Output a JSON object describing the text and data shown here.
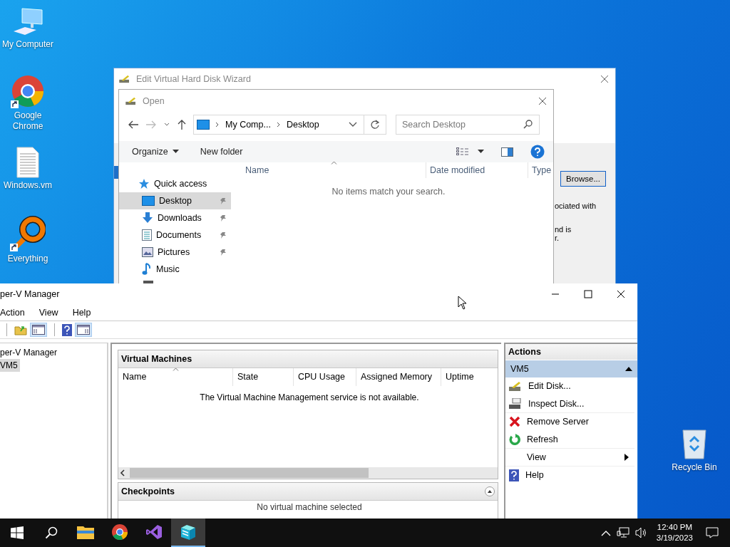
{
  "desktop_icons": [
    {
      "label": "My Computer",
      "kind": "computer",
      "shortcut": false
    },
    {
      "label": "Google Chrome",
      "kind": "chrome",
      "shortcut": true
    },
    {
      "label": "Windows.vm",
      "kind": "file",
      "shortcut": false
    },
    {
      "label": "Everything",
      "kind": "everything",
      "shortcut": true
    },
    {
      "label": "Recycle Bin",
      "kind": "bin",
      "shortcut": false
    }
  ],
  "wizard": {
    "title": "Edit Virtual Hard Disk Wizard",
    "browse_button": "Browse...",
    "text_fragments": [
      "ociated with",
      "nd is",
      "r."
    ]
  },
  "open_dialog": {
    "title": "Open",
    "breadcrumb": [
      "My Comp...",
      "Desktop"
    ],
    "search": {
      "placeholder": "Search Desktop"
    },
    "toolbar": [
      "Organize",
      "New folder"
    ],
    "nav": [
      {
        "label": "Quick access",
        "kind": "star",
        "selected": false,
        "pinned": false
      },
      {
        "label": "Desktop",
        "kind": "desktop",
        "selected": true,
        "pinned": true
      },
      {
        "label": "Downloads",
        "kind": "download",
        "selected": false,
        "pinned": true
      },
      {
        "label": "Documents",
        "kind": "document",
        "selected": false,
        "pinned": true
      },
      {
        "label": "Pictures",
        "kind": "pictures",
        "selected": false,
        "pinned": true
      },
      {
        "label": "Music",
        "kind": "music",
        "selected": false,
        "pinned": false
      }
    ],
    "columns": [
      "Name",
      "Date modified",
      "Type"
    ],
    "empty_message": "No items match your search."
  },
  "hyperv": {
    "title": "per-V Manager",
    "menu": [
      "Action",
      "View",
      "Help"
    ],
    "tree": [
      {
        "label": "per-V Manager",
        "selected": false,
        "children": [
          {
            "label": "VM5",
            "selected": true
          }
        ]
      }
    ],
    "vm_panel": {
      "title": "Virtual Machines",
      "columns": [
        "Name",
        "State",
        "CPU Usage",
        "Assigned Memory",
        "Uptime"
      ],
      "message": "The Virtual Machine Management service is not available."
    },
    "checkpoints": {
      "title": "Checkpoints",
      "message": "No virtual machine selected"
    },
    "actions": {
      "title": "Actions",
      "group": "VM5",
      "items": [
        {
          "label": "Edit Disk...",
          "kind": "edit-disk"
        },
        {
          "label": "Inspect Disk...",
          "kind": "inspect-disk"
        },
        {
          "label": "Remove Server",
          "kind": "remove"
        },
        {
          "label": "Refresh",
          "kind": "refresh"
        },
        {
          "label": "View",
          "kind": "submenu"
        },
        {
          "label": "Help",
          "kind": "help"
        }
      ]
    }
  },
  "taskbar": {
    "apps": [
      {
        "kind": "explorer",
        "selected": false
      },
      {
        "kind": "chrome",
        "selected": false
      },
      {
        "kind": "visual-studio",
        "selected": false
      },
      {
        "kind": "hyperv",
        "selected": true
      }
    ],
    "time": "12:40 PM",
    "date": "3/19/2023"
  }
}
